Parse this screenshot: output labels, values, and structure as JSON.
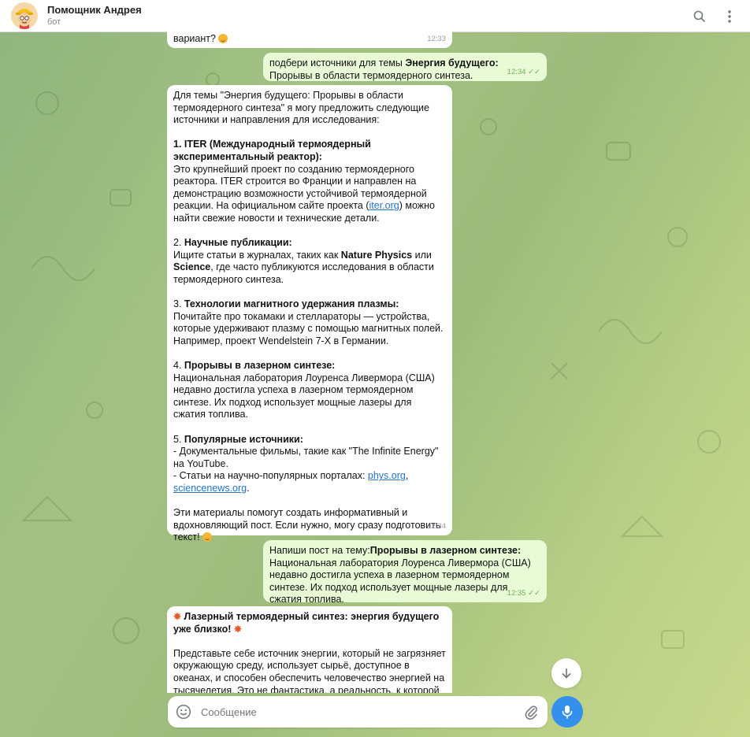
{
  "header": {
    "title": "Помощник Андрея",
    "subtitle": "бот"
  },
  "messages": {
    "m0": {
      "text": "вариант?",
      "time": "12:33"
    },
    "m1": {
      "prefix": "подбери источники для темы ",
      "bold": "Энергия будущего:",
      "suffix": " Прорывы в области термоядерного синтеза.",
      "time": "12:34"
    },
    "m2": {
      "intro": "Для темы \"Энергия будущего: Прорывы в области термоядерного синтеза\" я могу предложить следующие источники и направления для исследования:",
      "s1_title": "1. ITER (Международный термоядерный экспериментальный реактор):",
      "s1_text_a": "Это крупнейший проект по созданию термоядерного реактора. ITER строится во Франции и направлен на демонстрацию возможности устойчивой термоядерной реакции. На официальном сайте проекта (",
      "s1_link": "iter.org",
      "s1_text_b": ") можно найти свежие новости и технические детали.",
      "s2_num": "2. ",
      "s2_title": "Научные публикации:",
      "s2_text_a": "Ищите статьи в журналах, таких как ",
      "s2_j1": "Nature Physics",
      "s2_text_b": " или ",
      "s2_j2": "Science",
      "s2_text_c": ", где часто публикуются исследования в области термоядерного синтеза.",
      "s3_num": "3. ",
      "s3_title": "Технологии магнитного удержания плазмы:",
      "s3_text": "Почитайте про токамаки и стеллараторы — устройства, которые удерживают плазму с помощью магнитных полей. Например, проект Wendelstein 7-X в Германии.",
      "s4_num": "4. ",
      "s4_title": "Прорывы в лазерном синтезе:",
      "s4_text": "Национальная лаборатория Лоуренса Ливермора (США) недавно достигла успеха в лазерном термоядерном синтезе. Их подход использует мощные лазеры для сжатия топлива.",
      "s5_num": "5. ",
      "s5_title": "Популярные источники:",
      "s5_line1": "- Документальные фильмы, такие как \"The Infinite Energy\" на YouTube.",
      "s5_line2_a": "- Статьи на научно-популярных порталах: ",
      "s5_link1": "phys.org",
      "s5_comma": ", ",
      "s5_link2": "sciencenews.org",
      "s5_dot": ".",
      "outro": "Эти материалы помогут создать информативный и вдохновляющий пост. Если нужно, могу сразу подготовить текст!",
      "time": "12:34"
    },
    "m3": {
      "prefix": "Напиши пост на тему:",
      "bold": "Прорывы в лазерном синтезе:",
      "body": "Национальная лаборатория Лоуренса Ливермора (США) недавно достигла успеха в лазерном термоядерном синтезе. Их подход использует мощные лазеры для сжатия топлива.",
      "time": "12:35"
    },
    "m4": {
      "title": " Лазерный термоядерный синтез: энергия будущего уже близко! ",
      "body": "Представьте себе источник энергии, который не загрязняет окружающую среду, использует сырьё, доступное в океанах, и способен обеспечить человечество энергией на тысячелетия. Это не фантастика, а реальность, к которой мы"
    }
  },
  "composer": {
    "placeholder": "Сообщение"
  },
  "colors": {
    "accent": "#3390ec",
    "outgoing": "#e9fbd6",
    "incoming": "#ffffff"
  },
  "icons": {
    "search": "search-icon",
    "menu": "more-vertical-icon",
    "emoji": "smile-icon",
    "attach": "paperclip-icon",
    "mic": "microphone-icon",
    "scroll": "arrow-down-icon"
  }
}
